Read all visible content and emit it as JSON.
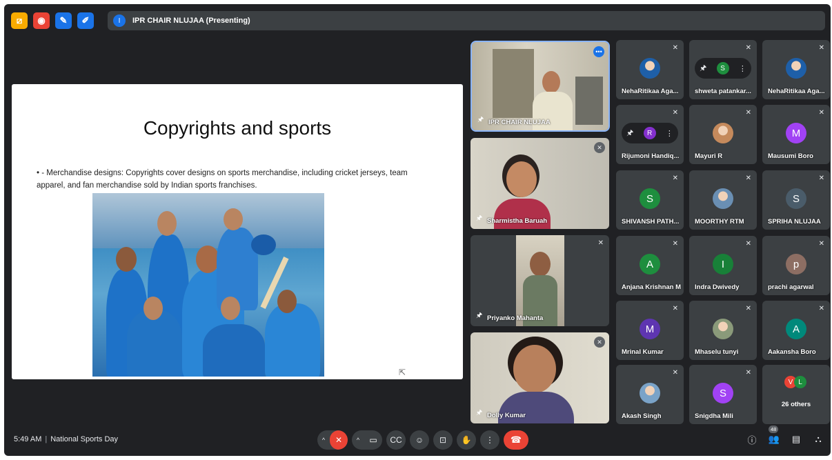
{
  "topbar": {
    "icons": [
      "pin-icon",
      "record-icon",
      "notes-icon",
      "edit-icon"
    ],
    "presenter_initial": "I",
    "presenting_label": "IPR CHAIR NLUJAA (Presenting)"
  },
  "slide": {
    "title": "Copyrights and sports",
    "bullet": "• - Merchandise designs: Copyrights cover designs on sports merchandise, including cricket jerseys, team apparel, and fan merchandise sold by Indian sports franchises."
  },
  "video_tiles": [
    {
      "name": "IPR CHAIR NLUJAA"
    },
    {
      "name": "Sharmistha Baruah"
    },
    {
      "name": "Priyanko Mahanta"
    },
    {
      "name": "Dolly Kumar"
    }
  ],
  "participants": [
    {
      "name": "NehaRitikaa Aga...",
      "initial": "",
      "color": "#1e5fa8"
    },
    {
      "name": "shweta patankar...",
      "initial": "S",
      "color": "#1e8e3e"
    },
    {
      "name": "NehaRitikaa Aga...",
      "initial": "",
      "color": "#1e5fa8"
    },
    {
      "name": "Rijumoni Handiq...",
      "initial": "R",
      "color": "#8430ce"
    },
    {
      "name": "Mayuri R",
      "initial": "",
      "color": "#c58a5c"
    },
    {
      "name": "Mausumi Boro",
      "initial": "M",
      "color": "#a142f4"
    },
    {
      "name": "SHIVANSH PATH...",
      "initial": "S",
      "color": "#1e8e3e"
    },
    {
      "name": "MOORTHY RTM",
      "initial": "",
      "color": "#6a8fb3"
    },
    {
      "name": "SPRIHA NLUJAA",
      "initial": "S",
      "color": "#4a5c6a"
    },
    {
      "name": "Anjana Krishnan M",
      "initial": "A",
      "color": "#1e8e3e"
    },
    {
      "name": "Indra Dwivedy",
      "initial": "I",
      "color": "#188038"
    },
    {
      "name": "prachi agarwal",
      "initial": "p",
      "color": "#8d6e63"
    },
    {
      "name": "Mrinal Kumar",
      "initial": "M",
      "color": "#5e35b1"
    },
    {
      "name": "Mhaselu tunyi",
      "initial": "",
      "color": "#8a9a7a"
    },
    {
      "name": "Aakansha Boro",
      "initial": "A",
      "color": "#00897b"
    },
    {
      "name": "Akash Singh",
      "initial": "",
      "color": "#7aa3c8"
    },
    {
      "name": "Snigdha Mili",
      "initial": "S",
      "color": "#a142f4"
    },
    {
      "name": "26 others",
      "initial": "",
      "color": ""
    }
  ],
  "others_initials": [
    "V",
    "L"
  ],
  "others_colors": [
    "#ea4335",
    "#1e8e3e"
  ],
  "bottom": {
    "time": "5:49 AM",
    "meeting_name": "National Sports Day",
    "participant_count": "48"
  }
}
